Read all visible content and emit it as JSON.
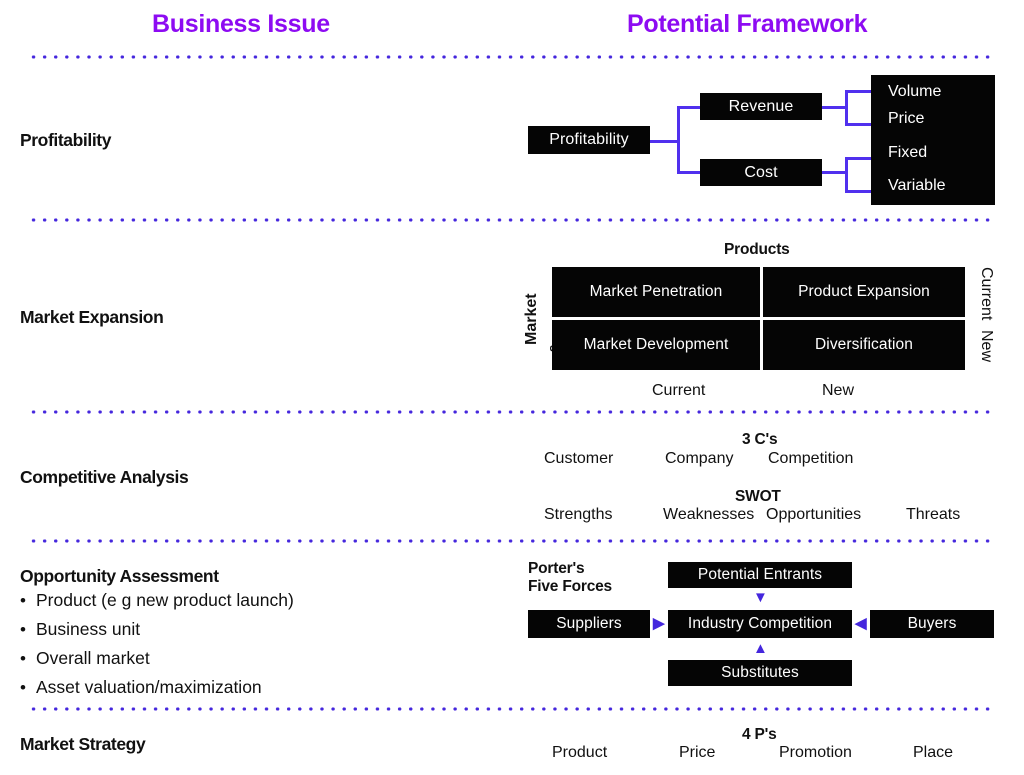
{
  "headers": {
    "left": "Business Issue",
    "right": "Potential Framework",
    "accent_color": "#8d0bf2",
    "separator_color": "#4426dd"
  },
  "rows": [
    {
      "label": "Profitability"
    },
    {
      "label": "Market Expansion"
    },
    {
      "label": "Competitive Analysis"
    },
    {
      "label": "Opportunity Assessment"
    },
    {
      "label": "Market Strategy"
    }
  ],
  "profitability_tree": {
    "root": "Profitability",
    "branches": [
      {
        "label": "Revenue",
        "children": [
          "Volume",
          "Price"
        ]
      },
      {
        "label": "Cost",
        "children": [
          "Fixed",
          "Variable"
        ]
      }
    ],
    "leaves": [
      "Volume",
      "Price",
      "Fixed",
      "Variable"
    ],
    "connector_color": "#5030ee"
  },
  "ansoff_matrix": {
    "top_axis_title": "Products",
    "left_axis_title": "Market",
    "left_axis_title_clip": "s",
    "bottom_labels": [
      "Current",
      "New"
    ],
    "right_labels": [
      "Current",
      "New"
    ],
    "cells": [
      [
        "Market Penetration",
        "Product Expansion"
      ],
      [
        "Market Development",
        "Diversification"
      ]
    ]
  },
  "competitive_analysis": {
    "three_cs": {
      "title": "3 C's",
      "items": [
        "Customer",
        "Company",
        "Competition"
      ]
    },
    "swot": {
      "title": "SWOT",
      "items": [
        "Strengths",
        "Weaknesses",
        "Opportunities",
        "Threats"
      ]
    }
  },
  "opportunity_assessment": {
    "bullets": [
      "Product (e g new product launch)",
      "Business unit",
      "Overall market",
      "Asset valuation/maximization"
    ],
    "porter": {
      "title_line1": "Porter's",
      "title_line2": "Five Forces",
      "top": "Potential Entrants",
      "left": "Suppliers",
      "center": "Industry Competition",
      "right": "Buyers",
      "bottom": "Substitutes",
      "arrow_color": "#4426dd"
    }
  },
  "market_strategy": {
    "four_ps": {
      "title": "4 P's",
      "items": [
        "Product",
        "Price",
        "Promotion",
        "Place"
      ]
    }
  }
}
